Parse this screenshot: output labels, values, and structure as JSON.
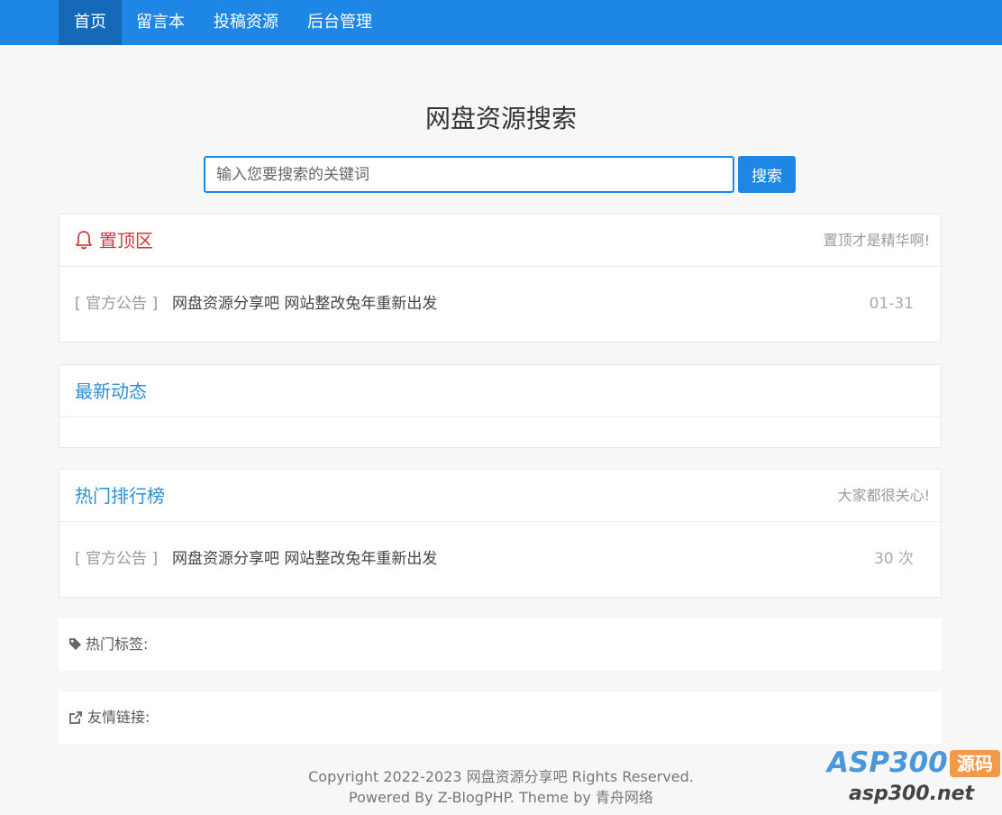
{
  "nav": {
    "items": [
      {
        "label": "首页",
        "active": true
      },
      {
        "label": "留言本",
        "active": false
      },
      {
        "label": "投稿资源",
        "active": false
      },
      {
        "label": "后台管理",
        "active": false
      }
    ]
  },
  "search": {
    "title": "网盘资源搜索",
    "placeholder": "输入您要搜索的关键词",
    "button_label": "搜索"
  },
  "pinned": {
    "title": "置顶区",
    "aside": "置顶才是精华啊!",
    "items": [
      {
        "category": "[ 官方公告 ]",
        "title": "网盘资源分享吧 网站整改兔年重新出发",
        "date": "01-31"
      }
    ]
  },
  "latest": {
    "title": "最新动态"
  },
  "hot": {
    "title": "热门排行榜",
    "aside": "大家都很关心!",
    "items": [
      {
        "category": "[ 官方公告 ]",
        "title": "网盘资源分享吧 网站整改兔年重新出发",
        "views": "30 次"
      }
    ]
  },
  "tags": {
    "label": "热门标签:"
  },
  "links": {
    "label": "友情链接:"
  },
  "footer": {
    "copyright": "Copyright 2022-2023 网盘资源分享吧 Rights Reserved.",
    "powered": "Powered By Z-BlogPHP. Theme by 青舟网络"
  },
  "watermark": {
    "brand": "ASP300",
    "badge": "源码",
    "domain": "asp300.net"
  },
  "colors": {
    "primary": "#1e87e5",
    "nav_active": "#1469b8",
    "pinned_red": "#d23a3a",
    "section_blue": "#2c8fd6"
  }
}
